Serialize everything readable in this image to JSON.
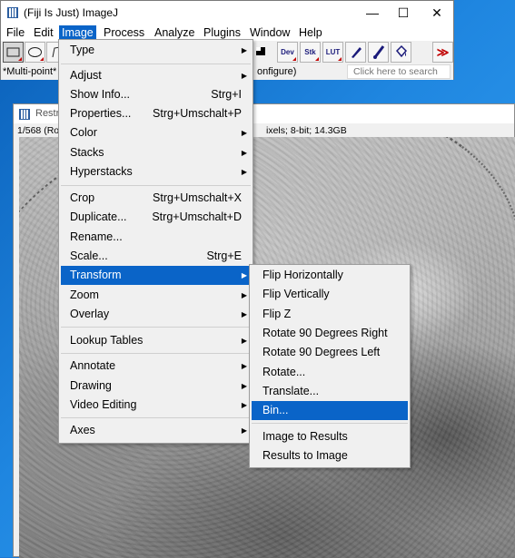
{
  "app": {
    "title": "(Fiji Is Just) ImageJ",
    "window_controls": [
      "—",
      "☐",
      "✕"
    ],
    "menubar": [
      "File",
      "Edit",
      "Image",
      "Process",
      "Analyze",
      "Plugins",
      "Window",
      "Help"
    ],
    "active_menu": "Image",
    "toolbar_labels": {
      "dev": "Dev",
      "stk": "Stk",
      "lut": "LUT",
      "more": "≫"
    },
    "status_left": "*Multi-point* o",
    "status_right": "onfigure)",
    "search_placeholder": "Click here to search"
  },
  "image_window": {
    "title": "Restr",
    "info_left": "1/568 (Ro",
    "info_right": "ixels; 8-bit; 14.3GB"
  },
  "image_menu": {
    "items": [
      {
        "label": "Type",
        "shortcut": "",
        "submenu": true
      },
      {
        "label": "Adjust",
        "shortcut": "",
        "submenu": true
      },
      {
        "label": "Show Info...",
        "shortcut": "Strg+I",
        "submenu": false
      },
      {
        "label": "Properties...",
        "shortcut": "Strg+Umschalt+P",
        "submenu": false
      },
      {
        "label": "Color",
        "shortcut": "",
        "submenu": true
      },
      {
        "label": "Stacks",
        "shortcut": "",
        "submenu": true
      },
      {
        "label": "Hyperstacks",
        "shortcut": "",
        "submenu": true
      },
      {
        "label": "Crop",
        "shortcut": "Strg+Umschalt+X",
        "submenu": false
      },
      {
        "label": "Duplicate...",
        "shortcut": "Strg+Umschalt+D",
        "submenu": false
      },
      {
        "label": "Rename...",
        "shortcut": "",
        "submenu": false
      },
      {
        "label": "Scale...",
        "shortcut": "Strg+E",
        "submenu": false
      },
      {
        "label": "Transform",
        "shortcut": "",
        "submenu": true
      },
      {
        "label": "Zoom",
        "shortcut": "",
        "submenu": true
      },
      {
        "label": "Overlay",
        "shortcut": "",
        "submenu": true
      },
      {
        "label": "Lookup Tables",
        "shortcut": "",
        "submenu": true
      },
      {
        "label": "Annotate",
        "shortcut": "",
        "submenu": true
      },
      {
        "label": "Drawing",
        "shortcut": "",
        "submenu": true
      },
      {
        "label": "Video Editing",
        "shortcut": "",
        "submenu": true
      },
      {
        "label": "Axes",
        "shortcut": "",
        "submenu": true
      }
    ],
    "highlighted": "Transform"
  },
  "transform_menu": {
    "items": [
      "Flip Horizontally",
      "Flip Vertically",
      "Flip Z",
      "Rotate 90 Degrees Right",
      "Rotate 90 Degrees Left",
      "Rotate...",
      "Translate...",
      "Bin...",
      "Image to Results",
      "Results to Image"
    ],
    "highlighted": "Bin..."
  },
  "colors": {
    "highlight": "#0a64c8",
    "desktop": "#1e78d4",
    "menu_bg": "#f0f0f0"
  }
}
